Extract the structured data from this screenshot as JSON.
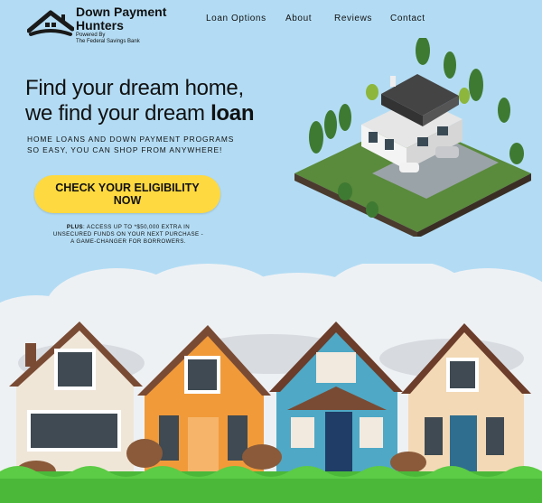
{
  "brand": {
    "title_line1": "Down Payment",
    "title_line2": "Hunters",
    "powered_by": "Powered By",
    "bank": "The Federal Savings Bank"
  },
  "nav": {
    "items": [
      {
        "label": "Loan Options"
      },
      {
        "label": "About"
      },
      {
        "label": "Reviews"
      },
      {
        "label": "Contact"
      }
    ]
  },
  "hero": {
    "headline_line1": "Find your dream home,",
    "headline_line2_prefix": "we find your dream ",
    "headline_line2_bold": "loan",
    "tagline_line1": "HOME LOANS AND DOWN PAYMENT PROGRAMS",
    "tagline_line2": "SO EASY, YOU CAN SHOP FROM ANYWHERE!",
    "cta_line1": "CHECK YOUR ELIGIBILITY",
    "cta_line2": "NOW",
    "promo_bold": "PLUS",
    "promo_line1_rest": ": ACCESS UP TO *$50,000 EXTRA IN",
    "promo_line2": "UNSECURED FUNDS ON YOUR NEXT PURCHASE -",
    "promo_line3": "A GAME-CHANGER FOR BORROWERS."
  },
  "colors": {
    "sky": "#b3dcf4",
    "cta": "#ffd940",
    "grass": "#4bb83a"
  },
  "icons": {
    "logo": "house-roof-logo-icon"
  }
}
